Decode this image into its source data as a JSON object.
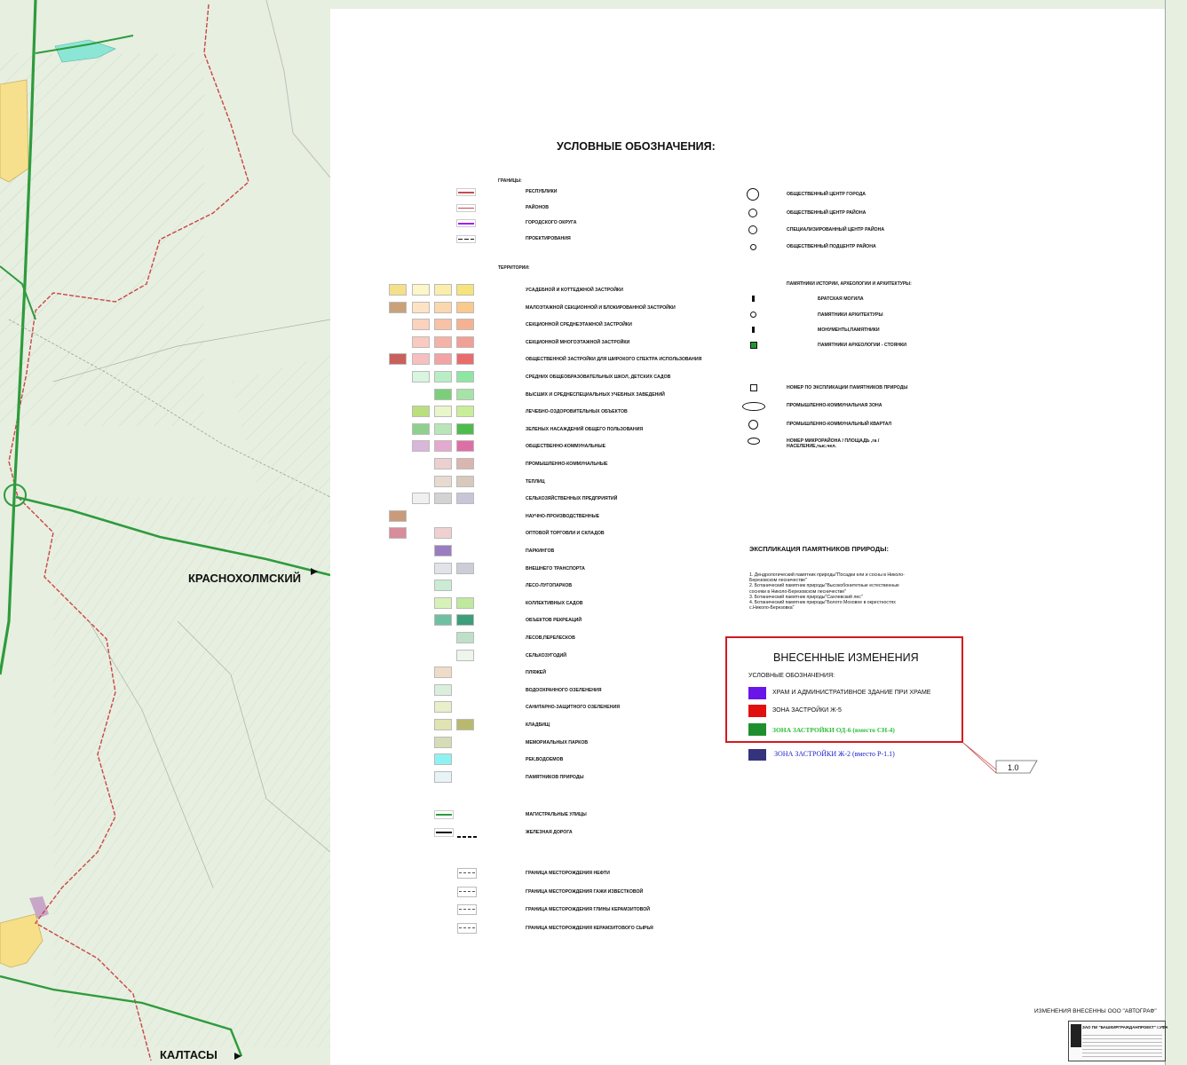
{
  "map": {
    "labels": {
      "krasnokholmsky": "КРАСНОХОЛМСКИЙ",
      "kaltasy": "КАЛТАСЫ"
    }
  },
  "legend": {
    "title": "УСЛОВНЫЕ ОБОЗНАЧЕНИЯ:",
    "borders_heading": "ГРАНИЦЫ:",
    "borders": [
      {
        "label": "РЕСПУБЛИКИ",
        "color": "#c0504d"
      },
      {
        "label": "РАЙОНОВ",
        "color": "#c0504d"
      },
      {
        "label": "ГОРОДСКОГО ОКРУГА",
        "color": "#a020f0"
      },
      {
        "label": "ПРОЕКТИРОВАНИЯ",
        "color": "#111111"
      }
    ],
    "territories_heading": "ТЕРРИТОРИИ:",
    "territories": [
      {
        "label": "УСАДЕБНОЙ И КОТТЕДЖНОЙ ЗАСТРОЙКИ",
        "colors": [
          "#f5e08a",
          "#fdf6c9",
          "#fbeeaa",
          "#f7e37c"
        ]
      },
      {
        "label": "МАЛОЭТАЖНОЙ СЕКЦИОННОЙ И БЛОКИРОВАННОЙ ЗАСТРОЙКИ",
        "colors": [
          "#c9a27a",
          "#fde3c4",
          "#fbd7ae",
          "#f9c98f"
        ]
      },
      {
        "label": "СЕКЦИОННОЙ СРЕДНЕЭТАЖНОЙ ЗАСТРОЙКИ",
        "colors": [
          "",
          "#fbd2bc",
          "#f8c2a6",
          "#f5b293"
        ]
      },
      {
        "label": "СЕКЦИОННОЙ МНОГОЭТАЖНОЙ ЗАСТРОЙКИ",
        "colors": [
          "",
          "#f9cbc0",
          "#f4b3a6",
          "#f29f95"
        ]
      },
      {
        "label": "ОБЩЕСТВЕННОЙ ЗАСТРОЙКИ ДЛЯ ШИРОКОГО СПЕКТРА ИСПОЛЬЗОВАНИЯ",
        "colors": [
          "#c8605c",
          "#f6c0c0",
          "#f2a3a3",
          "#ea6b6b"
        ]
      },
      {
        "label": "СРЕДНИХ ОБЩЕОБРАЗОВАТЕЛЬНЫХ ШКОЛ, ДЕТСКИХ САДОВ",
        "colors": [
          "",
          "#d8f5df",
          "#b9eec5",
          "#8ee6a3"
        ]
      },
      {
        "label": "ВЫСШИХ И СРЕДНЕСПЕЦИАЛЬНЫХ УЧЕБНЫХ ЗАВЕДЕНИЙ",
        "colors": [
          "",
          "",
          "#7bcf7b",
          "#a6e3a6"
        ]
      },
      {
        "label": "ЛЕЧЕБНО-ОЗДОРОВИТЕЛЬНЫХ ОБЪЕКТОВ",
        "colors": [
          "",
          "#b9e07c",
          "#e9f6c9",
          "#c9ee98"
        ]
      },
      {
        "label": "ЗЕЛЕНЫХ НАСАЖДЕНИЙ ОБЩЕГО ПОЛЬЗОВАНИЯ",
        "colors": [
          "",
          "#8fd08f",
          "#b8e6b8",
          "#4cbc4c"
        ]
      },
      {
        "label": "ОБЩЕСТВЕННО-КОММУНАЛЬНЫЕ",
        "colors": [
          "",
          "#d9b7d9",
          "#e5a9cf",
          "#de6fa6"
        ]
      },
      {
        "label": "ПРОМЫШЛЕННО-КОММУНАЛЬНЫЕ",
        "colors": [
          "",
          "",
          "#ecd0d0",
          "#d9b6b0"
        ]
      },
      {
        "label": "ТЕПЛИЦ",
        "colors": [
          "",
          "",
          "#e7dbd0",
          "#d8c9bc"
        ]
      },
      {
        "label": "СЕЛЬХОЗЯЙСТВЕННЫХ ПРЕДПРИЯТИЙ",
        "colors": [
          "",
          "#f0f0f0",
          "#d3d3d3",
          "#c6c6d8"
        ]
      },
      {
        "label": "НАУЧНО-ПРОИЗВОДСТВЕННЫЕ",
        "colors": [
          "#c99b7a",
          "",
          "",
          ""
        ]
      },
      {
        "label": "ОПТОВОЙ ТОРГОВЛИ И СКЛАДОВ",
        "colors": [
          "#d98c9b",
          "",
          "#efd1d1",
          ""
        ]
      },
      {
        "label": "ПАРКИНГОВ",
        "colors": [
          "",
          "",
          "#9a7cc0",
          ""
        ]
      },
      {
        "label": "ВНЕШНЕГО ТРАНСПОРТА",
        "colors": [
          "",
          "",
          "#e2e2ea",
          "#cdcdd9"
        ]
      },
      {
        "label": "ЛЕСО-ЛУГОПАРКОВ",
        "colors": [
          "",
          "",
          "#c9ecd3",
          ""
        ]
      },
      {
        "label": "КОЛЛЕКТИВНЫХ САДОВ",
        "colors": [
          "",
          "",
          "#d6f2b8",
          "#bfe99d"
        ]
      },
      {
        "label": "ОБЪЕКТОВ РЕКРЕАЦИЙ",
        "colors": [
          "",
          "",
          "#6fc0a2",
          "#3c9e7a"
        ]
      },
      {
        "label": "ЛЕСОВ,ПЕРЕЛЕСКОВ",
        "colors": [
          "",
          "",
          "",
          "#bfe0c8"
        ]
      },
      {
        "label": "СЕЛЬХОЗУГОДИЙ",
        "colors": [
          "",
          "",
          "",
          "#eef5ec"
        ]
      },
      {
        "label": "ПЛЯЖЕЙ",
        "colors": [
          "",
          "",
          "#efdcc8",
          ""
        ]
      },
      {
        "label": "ВОДООХРАННОГО ОЗЕЛЕНЕНИЯ",
        "colors": [
          "",
          "",
          "#dbeedd",
          ""
        ]
      },
      {
        "label": "САНИТАРНО-ЗАЩИТНОГО ОЗЕЛЕНЕНИЯ",
        "colors": [
          "",
          "",
          "#e8efc9",
          ""
        ]
      },
      {
        "label": "КЛАДБИЩ",
        "colors": [
          "",
          "",
          "#e1e3b2",
          "#b9b86f"
        ]
      },
      {
        "label": "МЕМОРИАЛЬНЫХ ПАРКОВ",
        "colors": [
          "",
          "",
          "#d6dcb6",
          ""
        ]
      },
      {
        "label": "РЕК,ВОДОЕМОВ",
        "colors": [
          "",
          "",
          "#8ff2f2",
          ""
        ]
      },
      {
        "label": "ПАМЯТНИКОВ ПРИРОДЫ",
        "colors": [
          "",
          "",
          "#e6f3f7",
          ""
        ]
      }
    ],
    "roads": [
      {
        "label": "МАГИСТРАЛЬНЫЕ УЛИЦЫ",
        "color": "#2e9b3d"
      },
      {
        "label": "ЖЕЛЕЗНАЯ ДОРОГА",
        "color": "#111111"
      }
    ],
    "deposits": [
      {
        "label": "ГРАНИЦА МЕСТОРОЖДЕНИЯ НЕФТИ"
      },
      {
        "label": "ГРАНИЦА МЕСТОРОЖДЕНИЯ ГАЖИ ИЗВЕСТКОВОЙ"
      },
      {
        "label": "ГРАНИЦА МЕСТОРОЖДЕНИЯ ГЛИНЫ КЕРАМЗИТОВОЙ"
      },
      {
        "label": "ГРАНИЦА МЕСТОРОЖДЕНИЯ КЕРАМЗИТОВОГО СЫРЬЯ"
      }
    ],
    "centers": [
      {
        "label": "ОБЩЕСТВЕННЫЙ ЦЕНТР ГОРОДА",
        "icon": "city-center-icon"
      },
      {
        "label": "ОБЩЕСТВЕННЫЙ ЦЕНТР РАЙОНА",
        "icon": "district-center-icon"
      },
      {
        "label": "СПЕЦИАЛИЗИРОВАННЫЙ ЦЕНТР РАЙОНА",
        "icon": "specialized-center-icon"
      },
      {
        "label": "ОБЩЕСТВЕННЫЙ ПОДЦЕНТР РАЙОНА",
        "icon": "subcenter-icon"
      }
    ],
    "monuments_heading": "ПАМЯТНИКИ ИСТОРИИ, АРХЕОЛОГИИ И АРХИТЕКТУРЫ:",
    "monuments": [
      {
        "label": "БРАТСКАЯ МОГИЛА",
        "icon": "mass-grave-icon"
      },
      {
        "label": "ПАМЯТНИКИ АРХИТЕКТУРЫ",
        "icon": "architecture-monument-icon"
      },
      {
        "label": "МОНУМЕНТЫ,ПАМЯТНИКИ",
        "icon": "monument-icon"
      },
      {
        "label": "ПАМЯТНИКИ АРХЕОЛОГИИ - СТОЯНКИ",
        "icon": "archaeology-icon"
      }
    ],
    "other": [
      {
        "label": "НОМЕР ПО ЭКСПЛИКАЦИИ ПАМЯТНИКОВ ПРИРОДЫ",
        "icon": "nature-number-icon"
      },
      {
        "label": "ПРОМЫШЛЕННО-КОММУНАЛЬНАЯ ЗОНА",
        "icon": "industrial-zone-icon"
      },
      {
        "label": "ПРОМЫШЛЕННО-КОММУНАЛЬНЫЙ КВАРТАЛ",
        "icon": "industrial-block-icon"
      },
      {
        "label": "НОМЕР МИКРОРАЙОНА / ПЛОЩАДЬ ,га / НАСЕЛЕНИЕ,тыс.чел.",
        "icon": "microdistrict-icon"
      }
    ]
  },
  "explication": {
    "title": "ЭКСПЛИКАЦИЯ ПАМЯТНИКОВ ПРИРОДЫ:",
    "items": [
      "1. Дендрологический памятник природы\"Посадки ели и сосны в Николо-",
      "    Березовском лесничестве\"",
      "2. Ботанический памятник природы\"Высокобонитетные естественные",
      "    сосняки в Николо-Березовском лесничестве\"",
      "3. Ботанический памятник природы\"Сахлевский лес\"",
      "4. Ботанический памятник природы\"Болото Моховое в окрестностях",
      "    с.Николо-Березовка\""
    ]
  },
  "changes": {
    "title": "ВНЕСЕННЫЕ ИЗМЕНЕНИЯ",
    "subtitle": "УСЛОВНЫЕ ОБОЗНАЧЕНИЯ:",
    "items": [
      {
        "label": "ХРАМ И АДМИНИСТРАТИВНОЕ ЗДАНИЕ ПРИ ХРАМЕ",
        "color": "#6a16e8"
      },
      {
        "label": "ЗОНА ЗАСТРОЙКИ Ж-5",
        "color": "#e01010"
      },
      {
        "label": "ЗОНА ЗАСТРОЙКИ ОД-6 (вместо СН-4)",
        "color": "#1f8f2e"
      }
    ],
    "extra": {
      "label": "ЗОНА ЗАСТРОЙКИ Ж-2 (вместо Р-1.1)",
      "color": "#35337d"
    },
    "revision": "1.0"
  },
  "footer": {
    "note": "ИЗМЕНЕНИЯ ВНЕСЕННЫ ООО \"АВТОГРАФ\"",
    "org": "ЗАО ПИ \"БАШКИРГРАЖДАНПРОЕКТ\" г.УФА"
  }
}
